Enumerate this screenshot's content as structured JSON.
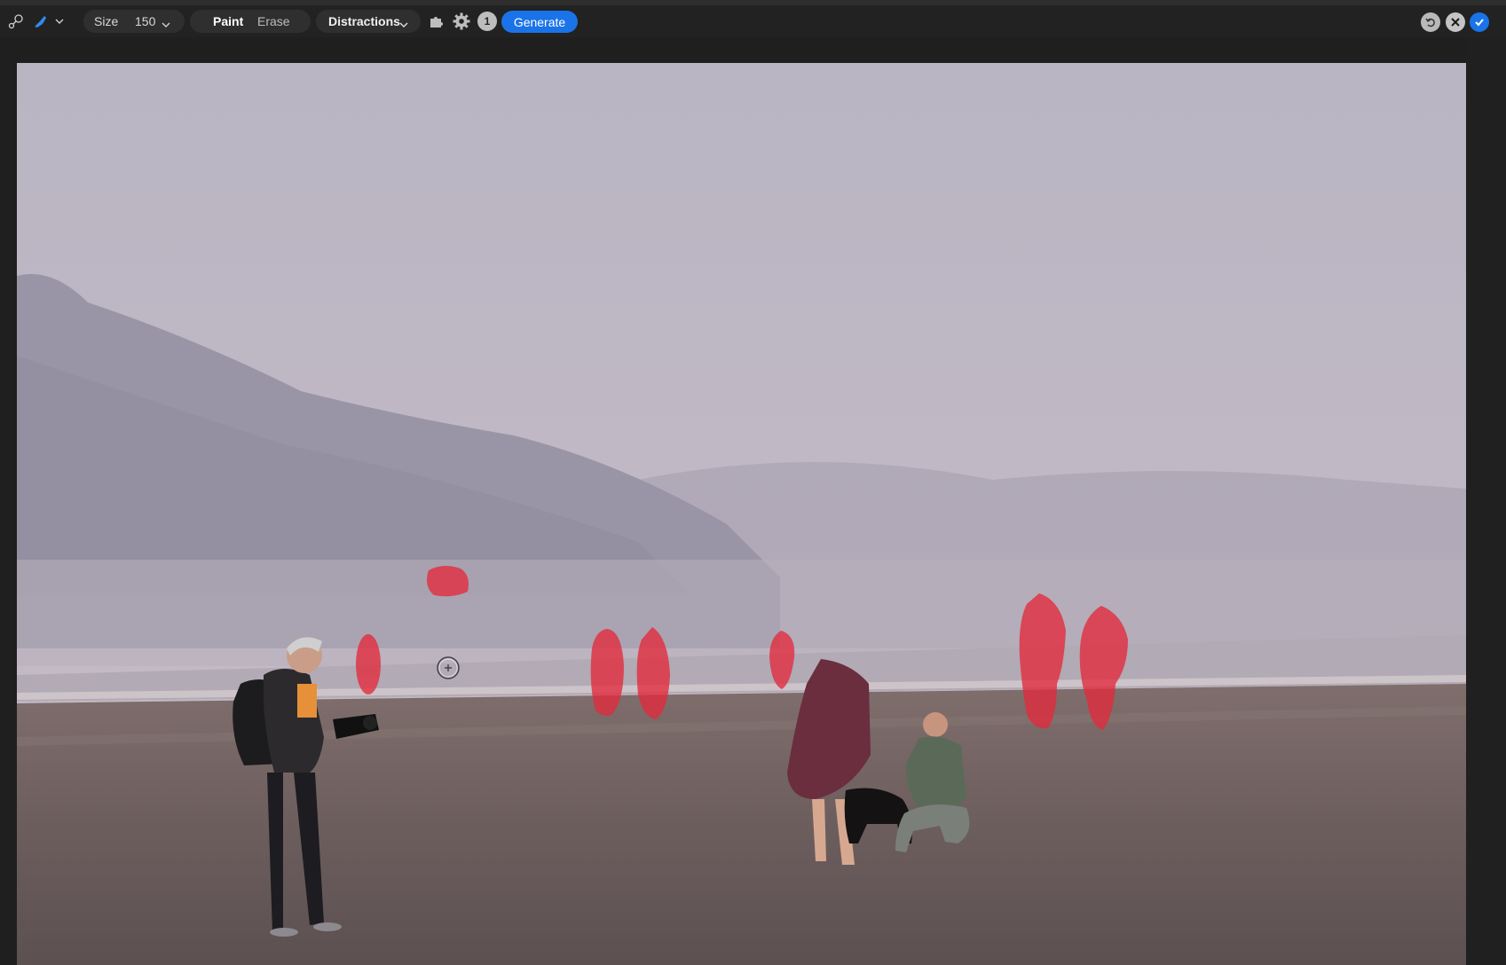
{
  "toolbar": {
    "size_label": "Size",
    "size_value": "150",
    "paint_label": "Paint",
    "erase_label": "Erase",
    "mode_select": "Distractions",
    "info_badge": "1",
    "generate_label": "Generate"
  },
  "icons": {
    "lasso": "lasso-icon",
    "brush": "brush-icon",
    "puzzle": "puzzle-icon",
    "settings": "gear-icon",
    "undo": "undo-icon",
    "close": "close-icon",
    "confirm": "check-icon"
  },
  "colors": {
    "accent": "#1a73e8",
    "mask": "#e32a3c",
    "toolbar_bg": "#222222"
  }
}
